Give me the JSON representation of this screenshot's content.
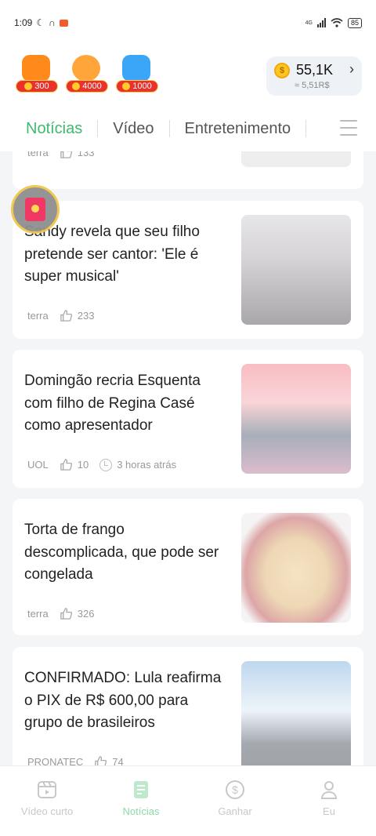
{
  "status_bar": {
    "time": "1:09",
    "network": "4G",
    "battery": "85"
  },
  "header": {
    "rewards": [
      {
        "icon": "tv-reward-icon",
        "amount": "300"
      },
      {
        "icon": "invite-reward-icon",
        "amount": "4000"
      },
      {
        "icon": "game-reward-icon",
        "amount": "1000"
      }
    ],
    "balance": {
      "coins": "55,1K",
      "brl": "≈ 5,51R$",
      "coin_symbol": "$"
    }
  },
  "tabs": [
    {
      "label": "Notícias",
      "active": true
    },
    {
      "label": "Vídeo",
      "active": false
    },
    {
      "label": "Entretenimento",
      "active": false
    }
  ],
  "feed": [
    {
      "title": "",
      "source": "terra",
      "likes": "133",
      "time": ""
    },
    {
      "title": "Sandy revela que seu filho pretende ser cantor: 'Ele é super musical'",
      "source": "terra",
      "likes": "233",
      "time": ""
    },
    {
      "title": "Domingão recria Esquenta com filho de Regina Casé como apresentador",
      "source": "UOL",
      "likes": "10",
      "time": "3 horas atrás"
    },
    {
      "title": "Torta de frango descomplicada, que pode ser congelada",
      "source": "terra",
      "likes": "326",
      "time": ""
    },
    {
      "title": "CONFIRMADO: Lula reafirma o PIX de R$ 600,00 para grupo de brasileiros",
      "source": "PRONATEC",
      "likes": "74",
      "time": ""
    }
  ],
  "bottom_nav": [
    {
      "label": "Vídeo curto",
      "icon": "short-video-icon",
      "active": false
    },
    {
      "label": "Notícias",
      "icon": "news-icon",
      "active": true
    },
    {
      "label": "Ganhar",
      "icon": "earn-dollar-icon",
      "active": false
    },
    {
      "label": "Eu",
      "icon": "profile-icon",
      "active": false
    }
  ],
  "colors": {
    "accent": "#3dbb6a",
    "reward_badge": "#e9312d",
    "coin": "#ffc61f"
  }
}
